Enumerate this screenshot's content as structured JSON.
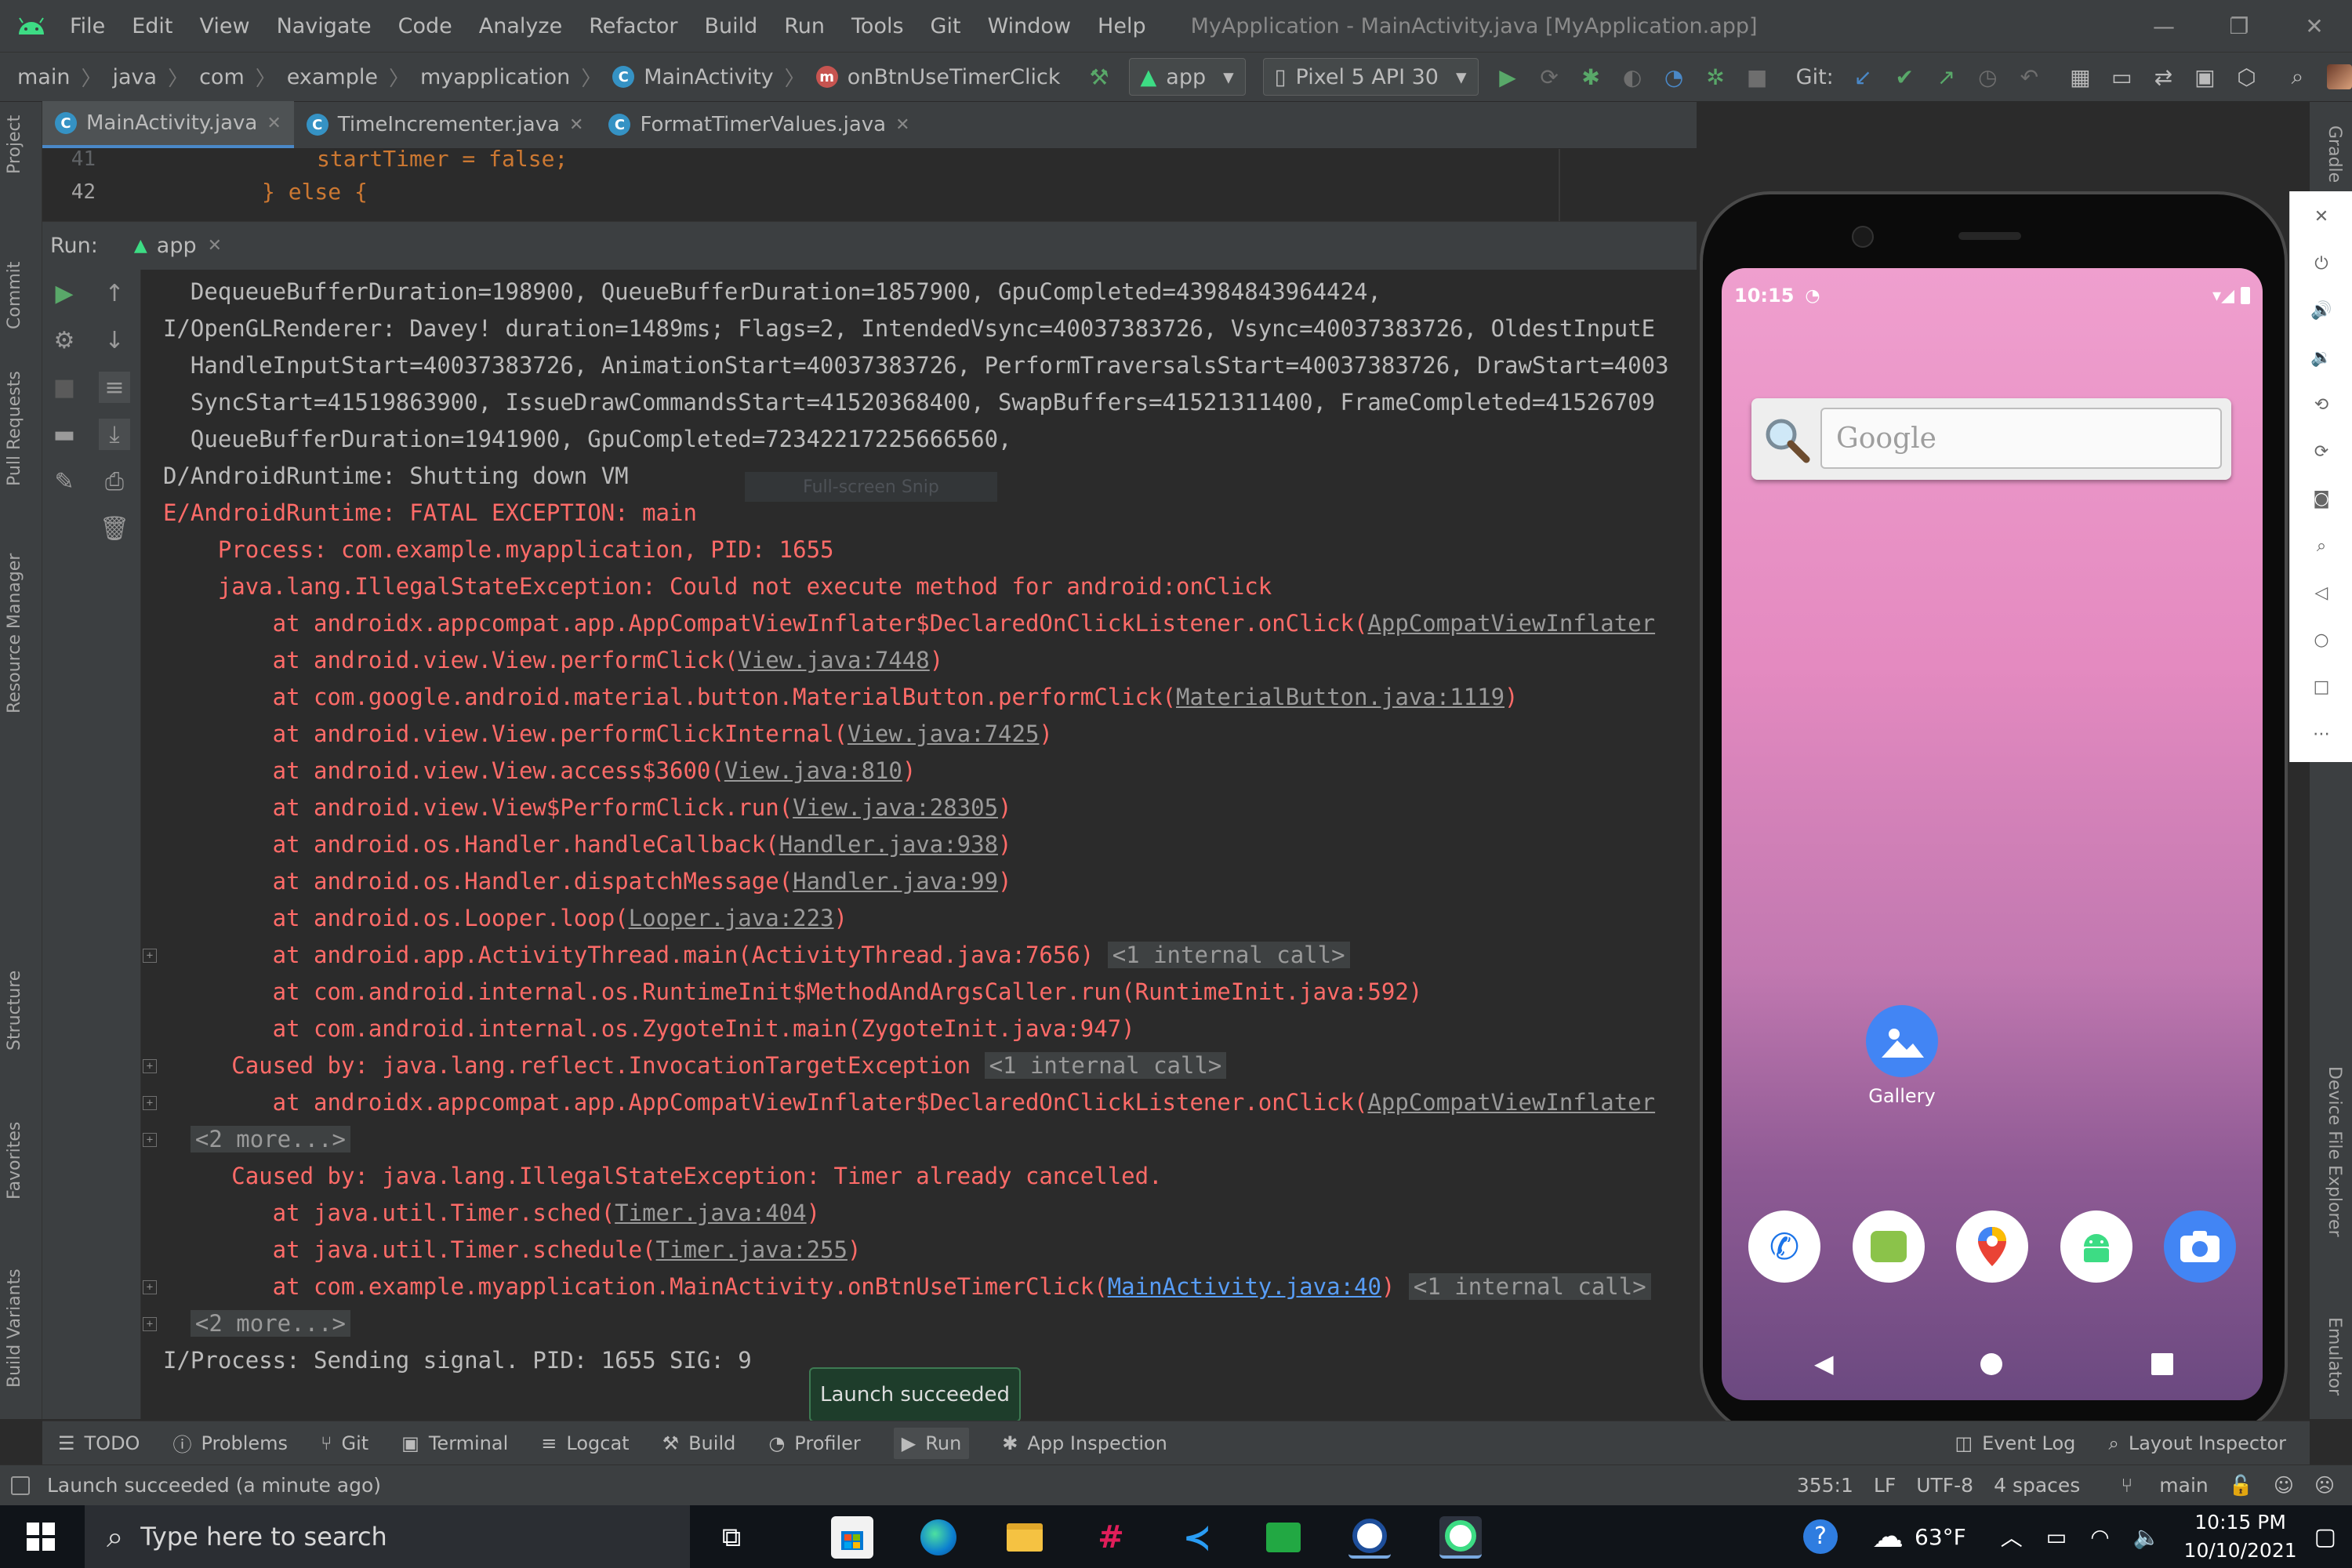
{
  "menubar": {
    "items": [
      "File",
      "Edit",
      "View",
      "Navigate",
      "Code",
      "Analyze",
      "Refactor",
      "Build",
      "Run",
      "Tools",
      "Git",
      "Window",
      "Help"
    ],
    "window_title": "MyApplication - MainActivity.java [MyApplication.app]"
  },
  "navbar": {
    "breadcrumbs": [
      "main",
      "java",
      "com",
      "example",
      "myapplication",
      "MainActivity",
      "onBtnUseTimerClick"
    ],
    "run_config": "app",
    "device": "Pixel 5 API 30",
    "git_label": "Git:"
  },
  "editor_tabs": [
    {
      "label": "MainActivity.java",
      "active": true
    },
    {
      "label": "TimeIncrementer.java",
      "active": false
    },
    {
      "label": "FormatTimerValues.java",
      "active": false
    }
  ],
  "editor": {
    "lines": [
      {
        "no": "41",
        "text": "startTimer = false;"
      },
      {
        "no": "42",
        "text": "} else {"
      }
    ]
  },
  "left_panels": [
    "Project",
    "Commit",
    "Pull Requests",
    "Resource Manager",
    "Structure",
    "Favorites",
    "Build Variants"
  ],
  "right_panels": [
    "Gradle",
    "Device File Explorer",
    "Emulator"
  ],
  "run_panel": {
    "label": "Run:",
    "tab": "app"
  },
  "console": {
    "lines": [
      {
        "cls": "norm",
        "parts": [
          {
            "t": "  DequeueBufferDuration=198900, QueueBufferDuration=1857900, GpuCompleted=43984843964424,"
          }
        ]
      },
      {
        "cls": "norm",
        "parts": [
          {
            "t": "I/OpenGLRenderer: Davey! duration=1489ms; Flags=2, IntendedVsync=40037383726, Vsync=40037383726, OldestInputE"
          }
        ]
      },
      {
        "cls": "norm",
        "parts": [
          {
            "t": "  HandleInputStart=40037383726, AnimationStart=40037383726, PerformTraversalsStart=40037383726, DrawStart=4003"
          }
        ]
      },
      {
        "cls": "norm",
        "parts": [
          {
            "t": "  SyncStart=41519863900, IssueDrawCommandsStart=41520368400, SwapBuffers=41521311400, FrameCompleted=41526709"
          }
        ]
      },
      {
        "cls": "norm",
        "parts": [
          {
            "t": "  QueueBufferDuration=1941900, GpuCompleted=72342217225666560,"
          }
        ]
      },
      {
        "cls": "norm",
        "parts": [
          {
            "t": "D/AndroidRuntime: Shutting down VM"
          }
        ]
      },
      {
        "cls": "err",
        "parts": [
          {
            "t": "E/AndroidRuntime: FATAL EXCEPTION: main"
          }
        ]
      },
      {
        "cls": "err",
        "parts": [
          {
            "t": "    Process: com.example.myapplication, PID: 1655"
          }
        ]
      },
      {
        "cls": "err",
        "parts": [
          {
            "t": "    java.lang.IllegalStateException: Could not execute method for android:onClick"
          }
        ]
      },
      {
        "cls": "err",
        "parts": [
          {
            "t": "        at androidx.appcompat.app.AppCompatViewInflater$DeclaredOnClickListener.onClick("
          },
          {
            "t": "AppCompatViewInflater",
            "k": "link"
          }
        ]
      },
      {
        "cls": "err",
        "parts": [
          {
            "t": "        at android.view.View.performClick("
          },
          {
            "t": "View.java:7448",
            "k": "link"
          },
          {
            "t": ")"
          }
        ]
      },
      {
        "cls": "err",
        "parts": [
          {
            "t": "        at com.google.android.material.button.MaterialButton.performClick("
          },
          {
            "t": "MaterialButton.java:1119",
            "k": "link"
          },
          {
            "t": ")"
          }
        ]
      },
      {
        "cls": "err",
        "parts": [
          {
            "t": "        at android.view.View.performClickInternal("
          },
          {
            "t": "View.java:7425",
            "k": "link"
          },
          {
            "t": ")"
          }
        ]
      },
      {
        "cls": "err",
        "parts": [
          {
            "t": "        at android.view.View.access$3600("
          },
          {
            "t": "View.java:810",
            "k": "link"
          },
          {
            "t": ")"
          }
        ]
      },
      {
        "cls": "err",
        "parts": [
          {
            "t": "        at android.view.View$PerformClick.run("
          },
          {
            "t": "View.java:28305",
            "k": "link"
          },
          {
            "t": ")"
          }
        ]
      },
      {
        "cls": "err",
        "parts": [
          {
            "t": "        at android.os.Handler.handleCallback("
          },
          {
            "t": "Handler.java:938",
            "k": "link"
          },
          {
            "t": ")"
          }
        ]
      },
      {
        "cls": "err",
        "parts": [
          {
            "t": "        at android.os.Handler.dispatchMessage("
          },
          {
            "t": "Handler.java:99",
            "k": "link"
          },
          {
            "t": ")"
          }
        ]
      },
      {
        "cls": "err",
        "parts": [
          {
            "t": "        at android.os.Looper.loop("
          },
          {
            "t": "Looper.java:223",
            "k": "link"
          },
          {
            "t": ")"
          }
        ]
      },
      {
        "cls": "err",
        "fold": true,
        "parts": [
          {
            "t": "        at android.app.ActivityThread.main(ActivityThread.java:7656)"
          },
          {
            "t": " "
          },
          {
            "t": "<1 internal call>",
            "k": "fold"
          }
        ]
      },
      {
        "cls": "err",
        "parts": [
          {
            "t": "        at com.android.internal.os.RuntimeInit$MethodAndArgsCaller.run(RuntimeInit.java:592)"
          }
        ]
      },
      {
        "cls": "err",
        "parts": [
          {
            "t": "        at com.android.internal.os.ZygoteInit.main(ZygoteInit.java:947)"
          }
        ]
      },
      {
        "cls": "err",
        "fold": true,
        "parts": [
          {
            "t": "     Caused by: java.lang.reflect.InvocationTargetException"
          },
          {
            "t": " "
          },
          {
            "t": "<1 internal call>",
            "k": "fold"
          }
        ]
      },
      {
        "cls": "err",
        "fold": true,
        "parts": [
          {
            "t": "        at androidx.appcompat.app.AppCompatViewInflater$DeclaredOnClickListener.onClick("
          },
          {
            "t": "AppCompatViewInflater",
            "k": "link"
          }
        ]
      },
      {
        "cls": "err",
        "fold": true,
        "parts": [
          {
            "t": "  "
          },
          {
            "t": "<2 more...>",
            "k": "fold"
          }
        ]
      },
      {
        "cls": "err",
        "parts": [
          {
            "t": "     Caused by: java.lang.IllegalStateException: Timer already cancelled."
          }
        ]
      },
      {
        "cls": "err",
        "parts": [
          {
            "t": "        at java.util.Timer.sched("
          },
          {
            "t": "Timer.java:404",
            "k": "link"
          },
          {
            "t": ")"
          }
        ]
      },
      {
        "cls": "err",
        "parts": [
          {
            "t": "        at java.util.Timer.schedule("
          },
          {
            "t": "Timer.java:255",
            "k": "link"
          },
          {
            "t": ")"
          }
        ]
      },
      {
        "cls": "err",
        "fold": true,
        "parts": [
          {
            "t": "        at com.example.myapplication.MainActivity.onBtnUseTimerClick("
          },
          {
            "t": "MainActivity.java:40",
            "k": "blue"
          },
          {
            "t": ")"
          },
          {
            "t": " "
          },
          {
            "t": "<1 internal call>",
            "k": "fold"
          }
        ]
      },
      {
        "cls": "err",
        "fold": true,
        "parts": [
          {
            "t": "  "
          },
          {
            "t": "<2 more...>",
            "k": "fold"
          }
        ]
      },
      {
        "cls": "norm",
        "parts": [
          {
            "t": "I/Process: Sending signal. PID: 1655 SIG: 9"
          }
        ]
      }
    ]
  },
  "snip_overlay": "Full-screen Snip",
  "toast": "Launch succeeded",
  "emulator": {
    "time": "10:15",
    "search_placeholder": "Google",
    "gallery_label": "Gallery"
  },
  "bottom_tabs": [
    "TODO",
    "Problems",
    "Git",
    "Terminal",
    "Logcat",
    "Build",
    "Profiler",
    "Run",
    "App Inspection"
  ],
  "bottom_right_tabs": [
    "Event Log",
    "Layout Inspector"
  ],
  "statusline": {
    "message": "Launch succeeded (a minute ago)",
    "position": "355:1",
    "line_sep": "LF",
    "encoding": "UTF-8",
    "indent": "4 spaces",
    "branch": "main"
  },
  "taskbar": {
    "search_placeholder": "Type here to search",
    "weather": "63°F",
    "time": "10:15 PM",
    "date": "10/10/2021"
  },
  "colors": {
    "ide_bg": "#2b2b2b",
    "panel_bg": "#3c3f41",
    "error_text": "#ff6b68",
    "accent_blue": "#589df6",
    "run_green": "#59a869"
  }
}
